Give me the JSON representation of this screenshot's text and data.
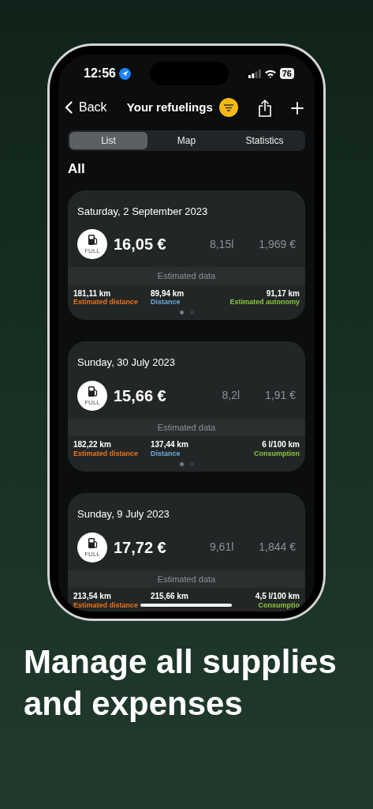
{
  "status_bar": {
    "time": "12:56",
    "battery": "76"
  },
  "nav": {
    "back": "Back",
    "title": "Your refuelings"
  },
  "tabs": [
    {
      "label": "List",
      "selected": true
    },
    {
      "label": "Map",
      "selected": false
    },
    {
      "label": "Statistics",
      "selected": false
    }
  ],
  "section_title": "All",
  "refuelings": [
    {
      "date": "Saturday, 2 September 2023",
      "badge": "FULL",
      "amount": "16,05 €",
      "liters": "8,15l",
      "price": "1,969 €",
      "estimated_title": "Estimated data",
      "stats": [
        {
          "value": "181,11 km",
          "label": "Estimated distance",
          "color": "#e8731a"
        },
        {
          "value": "89,94 km",
          "label": "Distance",
          "color": "#6aaedc"
        },
        {
          "value": "91,17 km",
          "label": "Estimated autonomy",
          "color": "#8cc63f"
        }
      ],
      "pages": [
        {
          "selected": true
        },
        {
          "selected": false
        }
      ]
    },
    {
      "date": "Sunday, 30 July 2023",
      "badge": "FULL",
      "amount": "15,66 €",
      "liters": "8,2l",
      "price": "1,91 €",
      "estimated_title": "Estimated data",
      "stats": [
        {
          "value": "182,22 km",
          "label": "Estimated distance",
          "color": "#e8731a"
        },
        {
          "value": "137,44 km",
          "label": "Distance",
          "color": "#6aaedc"
        },
        {
          "value": "6 l/100 km",
          "label": "Consumption",
          "color": "#8cc63f"
        }
      ],
      "pages": [
        {
          "selected": true
        },
        {
          "selected": false
        }
      ]
    },
    {
      "date": "Sunday, 9 July 2023",
      "badge": "FULL",
      "amount": "17,72 €",
      "liters": "9,61l",
      "price": "1,844 €",
      "estimated_title": "Estimated data",
      "stats": [
        {
          "value": "213,54 km",
          "label": "Estimated distance",
          "color": "#e8731a"
        },
        {
          "value": "215,66 km"
        },
        {
          "value": "4,5 l/100 km",
          "label": "Consumptio",
          "color": "#8cc63f"
        }
      ]
    }
  ],
  "headline": "Manage all supplies and expenses"
}
